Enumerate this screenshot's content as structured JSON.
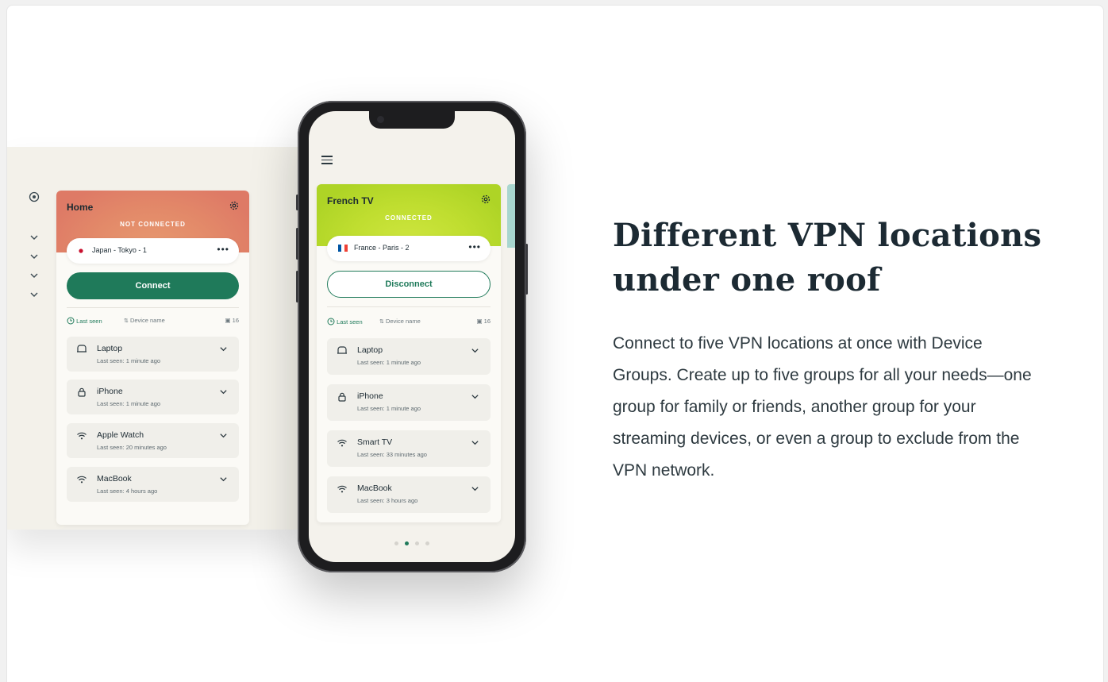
{
  "section": {
    "headline_line1": "Different VPN locations",
    "headline_line2": "under one roof",
    "body": "Connect to five VPN locations at once with Device Groups. Create up to five groups for all your needs—one group for family or friends, another group for your streaming devices, or even a group to exclude from the VPN network."
  },
  "desktop_card": {
    "title": "Home",
    "status": "NOT CONNECTED",
    "location": "Japan - Tokyo - 1",
    "more": "•••",
    "button": "Connect",
    "sort_last_seen": "Last seen",
    "sort_device_name": "Device name",
    "device_count": "16",
    "devices": [
      {
        "name": "Laptop",
        "seen": "Last seen: 1 minute ago",
        "icon": "laptop-icon"
      },
      {
        "name": "iPhone",
        "seen": "Last seen: 1 minute ago",
        "icon": "lock-icon"
      },
      {
        "name": "Apple Watch",
        "seen": "Last seen: 20 minutes ago",
        "icon": "wifi-icon"
      },
      {
        "name": "MacBook",
        "seen": "Last seen: 4 hours ago",
        "icon": "wifi-icon"
      }
    ]
  },
  "phone_card": {
    "title": "French TV",
    "status": "CONNECTED",
    "location": "France - Paris - 2",
    "more": "•••",
    "button": "Disconnect",
    "sort_last_seen": "Last seen",
    "sort_device_name": "Device name",
    "device_count": "16",
    "devices": [
      {
        "name": "Laptop",
        "seen": "Last seen: 1 minute ago",
        "icon": "laptop-icon"
      },
      {
        "name": "iPhone",
        "seen": "Last seen: 1 minute ago",
        "icon": "lock-icon"
      },
      {
        "name": "Smart TV",
        "seen": "Last seen: 33 minutes ago",
        "icon": "wifi-icon"
      },
      {
        "name": "MacBook",
        "seen": "Last seen: 3 hours ago",
        "icon": "wifi-icon"
      }
    ],
    "pager_active": 2,
    "pager_total": 4
  },
  "colors": {
    "accent": "#1f7a5a",
    "not_connected_head": "#e08066",
    "connected_head": "#b9dc2c"
  }
}
